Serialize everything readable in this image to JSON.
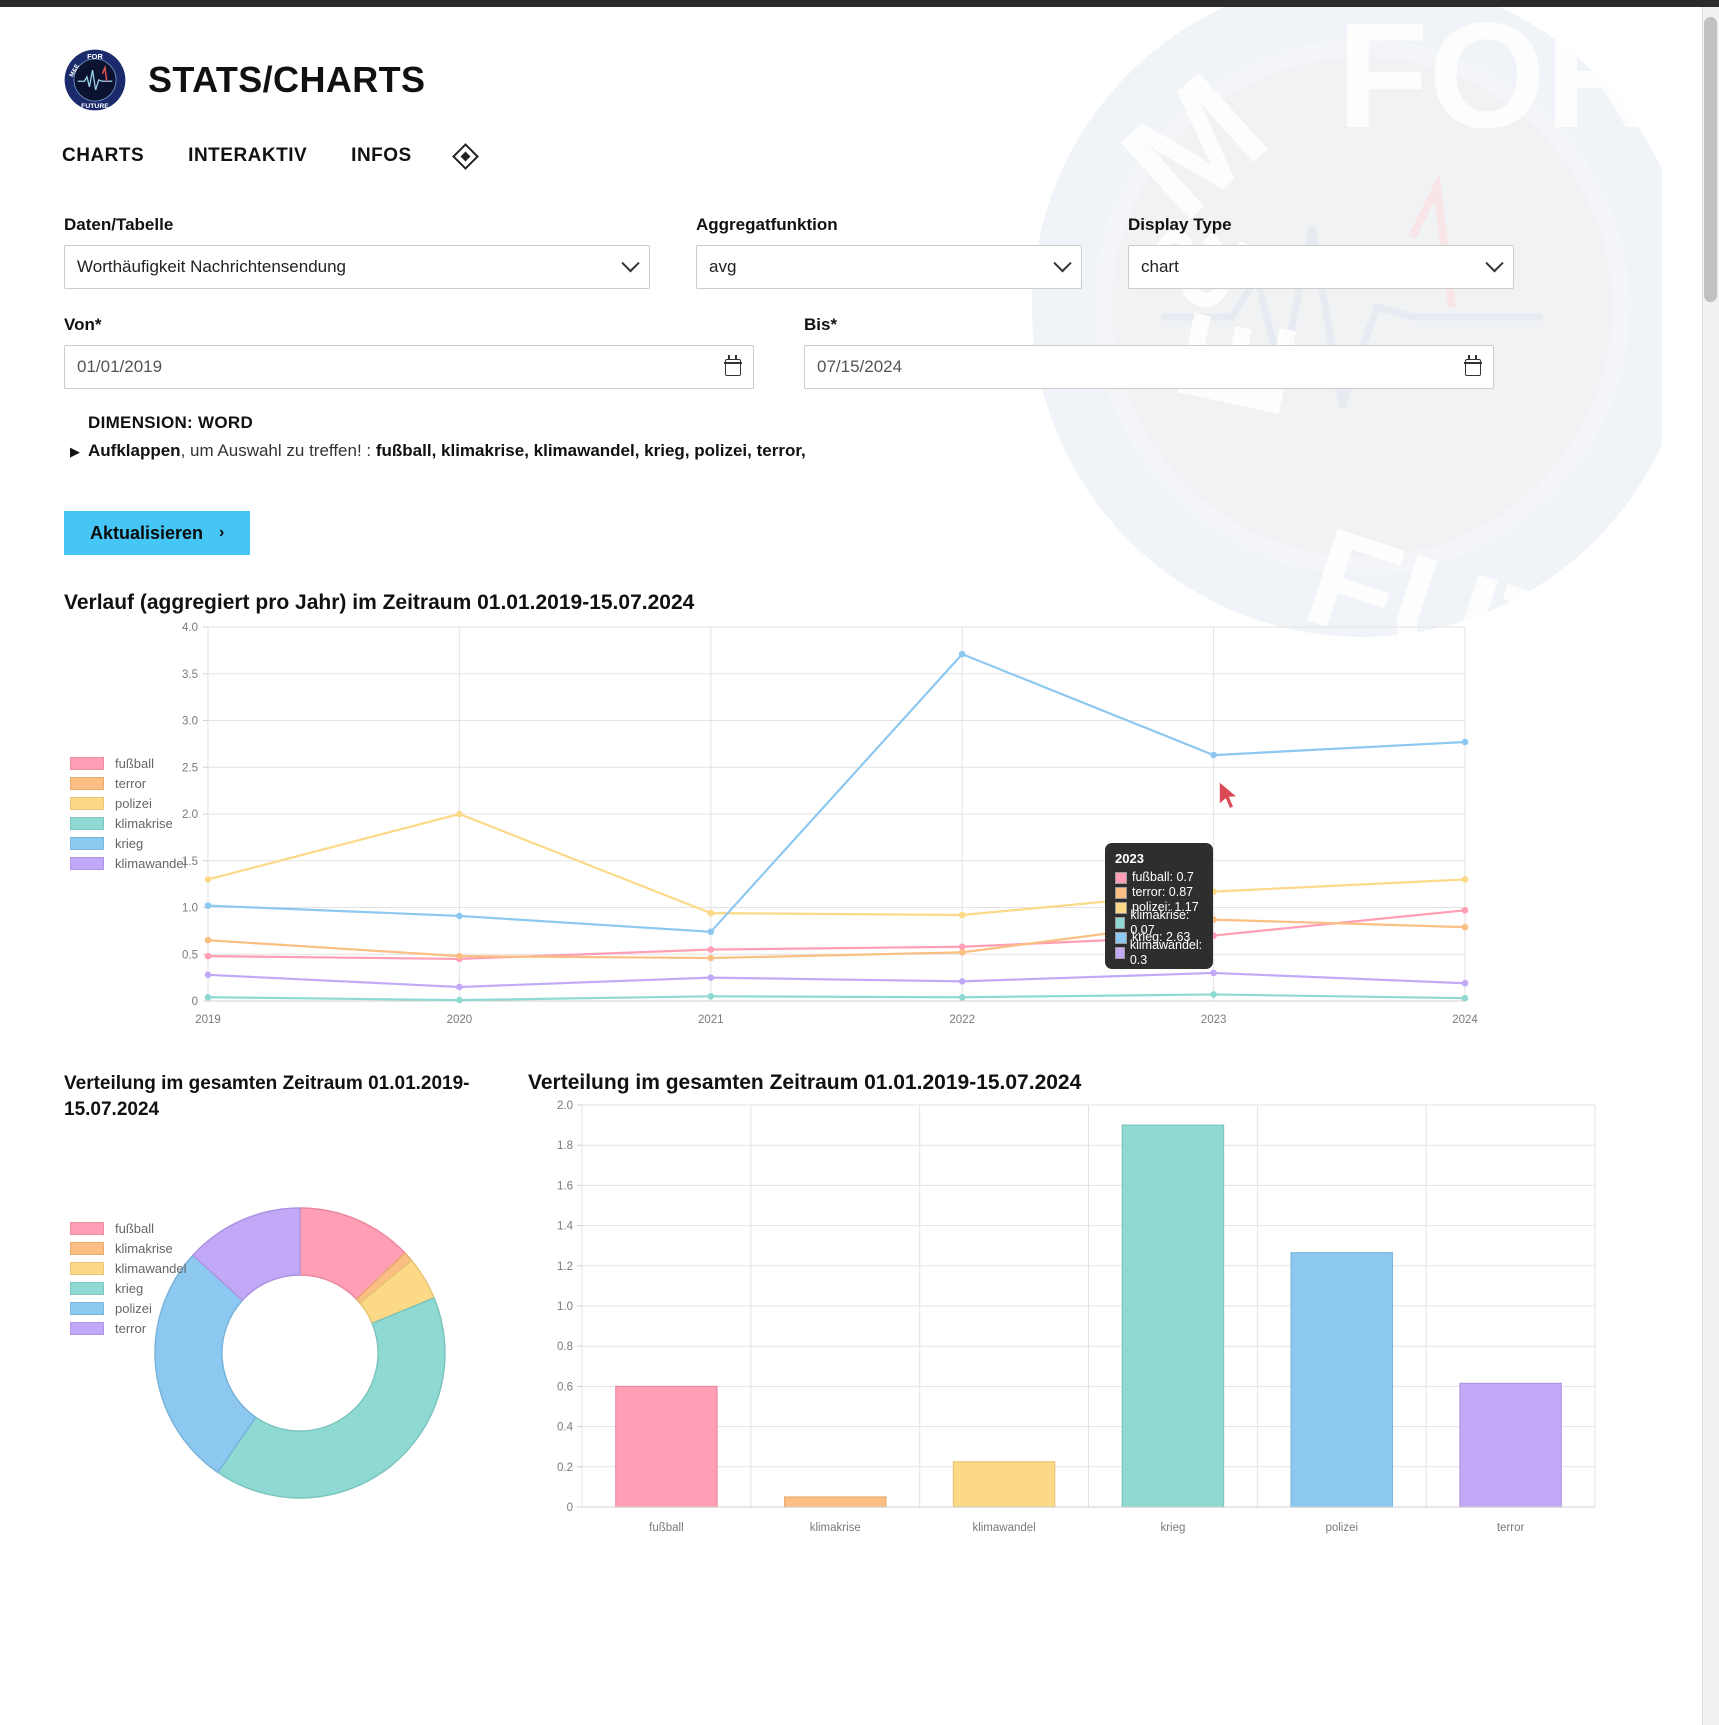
{
  "header": {
    "logo_icon": "mce-for-future-logo",
    "title": "STATS/CHARTS",
    "nav": [
      {
        "label": "CHARTS"
      },
      {
        "label": "INTERAKTIV"
      },
      {
        "label": "INFOS"
      }
    ],
    "nav_diamond_icon": "diamond-icon"
  },
  "form": {
    "daten_label": "Daten/Tabelle",
    "daten_value": "Worthäufigkeit Nachrichtensendung",
    "aggregat_label": "Aggregatfunktion",
    "aggregat_value": "avg",
    "display_label": "Display Type",
    "display_value": "chart",
    "von_label": "Von*",
    "von_value": "01/01/2019",
    "bis_label": "Bis*",
    "bis_value": "07/15/2024",
    "dimension_title": "DIMENSION: WORD",
    "dimension_toggle": "Aufklappen",
    "dimension_hint": ", um Auswahl zu treffen! : ",
    "dimension_words": [
      "fußball",
      "klimakrise",
      "klimawandel",
      "krieg",
      "polizei",
      "terror"
    ],
    "submit_label": "Aktualisieren",
    "submit_arrow": "›",
    "accent_color": "#45c6f5"
  },
  "tooltip": {
    "title": "2023",
    "rows": [
      {
        "label": "fußball: 0.7",
        "color": "#ff9eb5"
      },
      {
        "label": "terror: 0.87",
        "color": "#fbbf83"
      },
      {
        "label": "polizei: 1.17",
        "color": "#fcd987"
      },
      {
        "label": "klimakrise: 0.07",
        "color": "#8fd9d3"
      },
      {
        "label": "krieg: 2.63",
        "color": "#8cc8f0"
      },
      {
        "label": "klimawandel: 0.3",
        "color": "#c2a9f7"
      }
    ]
  },
  "chart_data": [
    {
      "id": "line",
      "type": "line",
      "title": "Verlauf (aggregiert pro Jahr) im Zeitraum 01.01.2019-15.07.2024",
      "x": [
        "2019",
        "2020",
        "2021",
        "2022",
        "2023",
        "2024"
      ],
      "xlabel": "",
      "ylabel": "",
      "ylim": [
        0,
        4.0
      ],
      "yticks": [
        "0",
        "0.5",
        "1.0",
        "1.5",
        "2.0",
        "2.5",
        "3.0",
        "3.5",
        "4.0"
      ],
      "grid": true,
      "legend_position": "left",
      "series": [
        {
          "name": "fußball",
          "color": "#ff9eb5",
          "values": [
            0.48,
            0.45,
            0.55,
            0.58,
            0.7,
            0.97
          ]
        },
        {
          "name": "terror",
          "color": "#fbbf83",
          "values": [
            0.65,
            0.48,
            0.46,
            0.52,
            0.87,
            0.79
          ]
        },
        {
          "name": "polizei",
          "color": "#fcd987",
          "values": [
            1.3,
            2.0,
            0.94,
            0.92,
            1.17,
            1.3
          ]
        },
        {
          "name": "klimakrise",
          "color": "#8fd9d3",
          "values": [
            0.04,
            0.01,
            0.05,
            0.04,
            0.07,
            0.03
          ]
        },
        {
          "name": "krieg",
          "color": "#8cc8f0",
          "values": [
            1.02,
            0.91,
            0.74,
            3.71,
            2.63,
            2.77
          ]
        },
        {
          "name": "klimawandel",
          "color": "#c2a9f7",
          "values": [
            0.28,
            0.15,
            0.25,
            0.21,
            0.3,
            0.19
          ]
        }
      ]
    },
    {
      "id": "donut",
      "type": "pie",
      "title": "Verteilung im gesamten Zeitraum 01.01.2019-15.07.2024",
      "legend_position": "left",
      "labels": [
        "fußball",
        "klimakrise",
        "klimawandel",
        "krieg",
        "polizei",
        "terror"
      ],
      "colors": [
        "#ff9eb5",
        "#fbbf83",
        "#fcd987",
        "#8fd9d3",
        "#8cc8f0",
        "#c2a9f7"
      ],
      "values": [
        0.6,
        0.05,
        0.225,
        1.9,
        1.265,
        0.615
      ]
    },
    {
      "id": "bar",
      "type": "bar",
      "title": "Verteilung im gesamten Zeitraum 01.01.2019-15.07.2024",
      "categories": [
        "fußball",
        "klimakrise",
        "klimawandel",
        "krieg",
        "polizei",
        "terror"
      ],
      "values": [
        0.6,
        0.05,
        0.225,
        1.9,
        1.265,
        0.615
      ],
      "colors": [
        "#ff9eb5",
        "#fbbf83",
        "#fcd987",
        "#8fd9d3",
        "#8cc8f0",
        "#c2a9f7"
      ],
      "ylim": [
        0,
        2.0
      ],
      "yticks": [
        "0",
        "0.2",
        "0.4",
        "0.6",
        "0.8",
        "1.0",
        "1.2",
        "1.4",
        "1.6",
        "1.8",
        "2.0"
      ],
      "xlabel": "",
      "ylabel": "",
      "grid": true
    }
  ]
}
